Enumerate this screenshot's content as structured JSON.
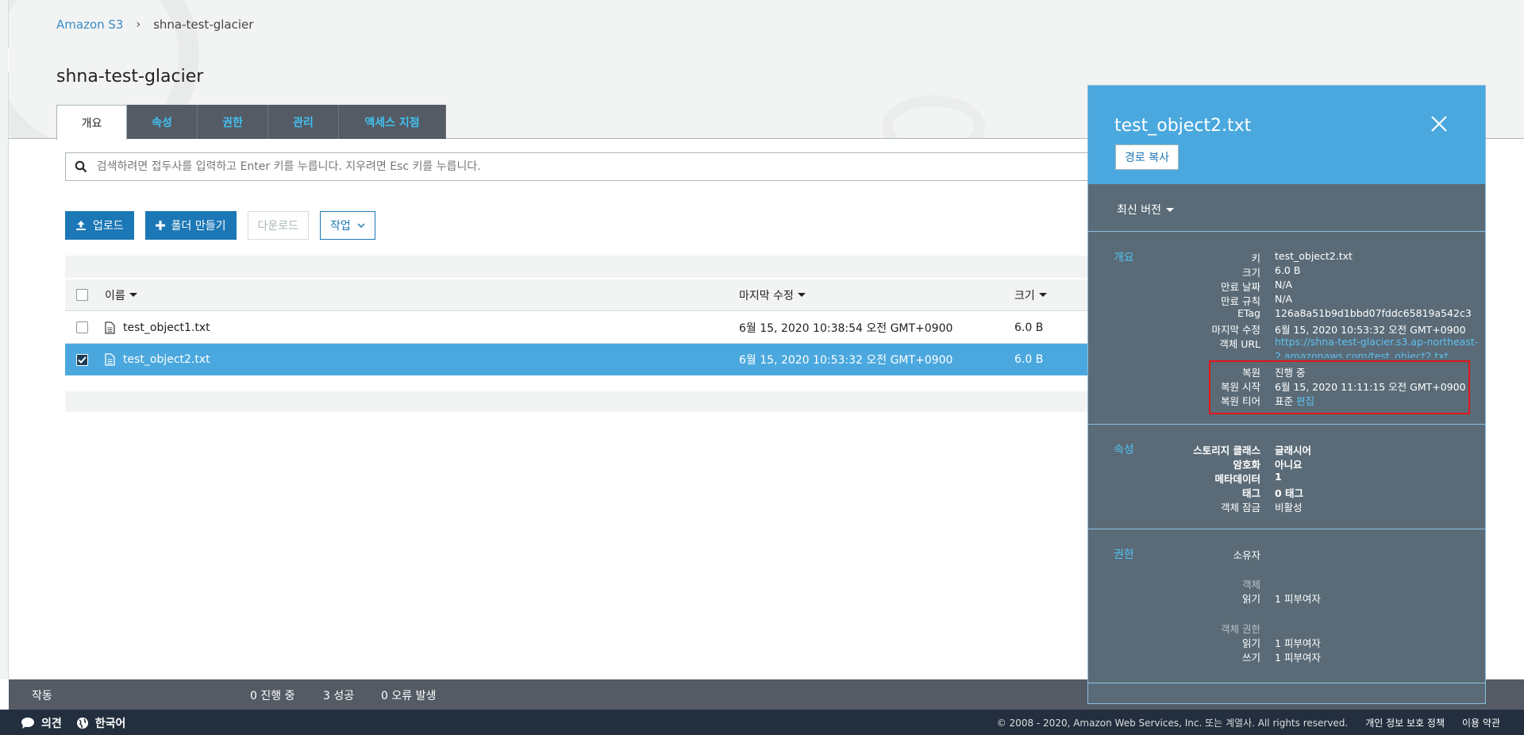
{
  "breadcrumb": {
    "root": "Amazon S3",
    "separator": "›",
    "current": "shna-test-glacier"
  },
  "bucket_title": "shna-test-glacier",
  "tabs": [
    {
      "label": "개요"
    },
    {
      "label": "속성"
    },
    {
      "label": "권한"
    },
    {
      "label": "관리"
    },
    {
      "label": "액세스 지점"
    }
  ],
  "search": {
    "placeholder": "검색하려면 접두사를 입력하고 Enter 키를 누릅니다. 지우려면 Esc 키를 누릅니다."
  },
  "actions": {
    "upload": "업로드",
    "create_folder": "폴더 만들기",
    "download": "다운로드",
    "actions": "작업"
  },
  "table": {
    "headers": {
      "name": "이름",
      "modified": "마지막 수정",
      "size": "크기"
    },
    "rows": [
      {
        "name": "test_object1.txt",
        "modified": "6월 15, 2020 10:38:54 오전 GMT+0900",
        "size": "6.0 B",
        "selected": false
      },
      {
        "name": "test_object2.txt",
        "modified": "6월 15, 2020 10:53:32 오전 GMT+0900",
        "size": "6.0 B",
        "selected": true
      }
    ]
  },
  "statusbar": {
    "label": "작동",
    "in_progress": "0 진행 중",
    "success": "3 성공",
    "errors": "0 오류 발생"
  },
  "footer": {
    "feedback": "의견",
    "language": "한국어",
    "copyright": "© 2008 - 2020, Amazon Web Services, Inc. 또는 계열사. All rights reserved.",
    "privacy": "개인 정보 보호 정책",
    "terms": "이용 약관"
  },
  "panel": {
    "title": "test_object2.txt",
    "copy_path": "경로 복사",
    "version": "최신 버전",
    "overview": {
      "title": "개요",
      "key_k": "키",
      "key_v": "test_object2.txt",
      "size_k": "크기",
      "size_v": "6.0 B",
      "expiry_date_k": "만료 날짜",
      "expiry_date_v": "N/A",
      "expiry_rule_k": "만료 규칙",
      "expiry_rule_v": "N/A",
      "etag_k": "ETag",
      "etag_v": "126a8a51b9d1bbd07fddc65819a542c3",
      "modified_k": "마지막 수정",
      "modified_v": "6월 15, 2020 10:53:32 오전 GMT+0900",
      "url_k": "객체 URL",
      "url_v1": "https://shna-test-glacier.s3.ap-northeast-",
      "url_v2": "2.amazonaws.com/test_object2.txt",
      "restore_k": "복원",
      "restore_v": "진행 중",
      "restore_start_k": "복원 시작",
      "restore_start_v": "6월 15, 2020 11:11:15 오전 GMT+0900",
      "restore_tier_k": "복원 티어",
      "restore_tier_v": "표준",
      "restore_tier_edit": "편집"
    },
    "properties": {
      "title": "속성",
      "storage_class_k": "스토리지 클래스",
      "storage_class_v": "글래시어",
      "encryption_k": "암호화",
      "encryption_v": "아니요",
      "metadata_k": "메타데이터",
      "metadata_v": "1",
      "tags_k": "태그",
      "tags_v": "0 태그",
      "lock_k": "객체 잠금",
      "lock_v": "비활성"
    },
    "permissions": {
      "title": "권한",
      "owner_k": "소유자",
      "object_k": "객체",
      "read_k": "읽기",
      "read_v": "1 피부여자",
      "object_acl_k": "객체 권한",
      "acl_read_k": "읽기",
      "acl_read_v": "1 피부여자",
      "acl_write_k": "쓰기",
      "acl_write_v": "1 피부여자"
    }
  }
}
